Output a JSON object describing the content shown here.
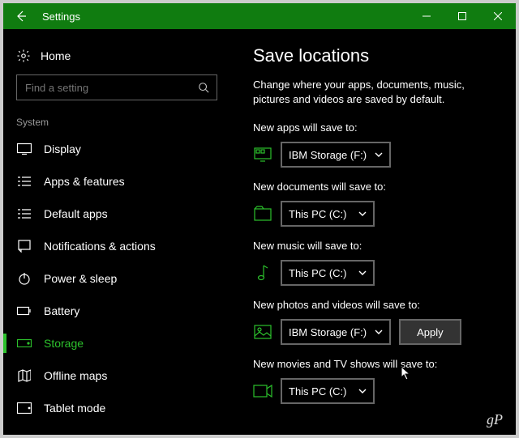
{
  "window": {
    "title": "Settings"
  },
  "sidebar": {
    "home": "Home",
    "search_placeholder": "Find a setting",
    "section": "System",
    "items": [
      {
        "label": "Display"
      },
      {
        "label": "Apps & features"
      },
      {
        "label": "Default apps"
      },
      {
        "label": "Notifications & actions"
      },
      {
        "label": "Power & sleep"
      },
      {
        "label": "Battery"
      },
      {
        "label": "Storage"
      },
      {
        "label": "Offline maps"
      },
      {
        "label": "Tablet mode"
      }
    ]
  },
  "page": {
    "title": "Save locations",
    "description": "Change where your apps, documents, music, pictures and videos are saved by default.",
    "groups": [
      {
        "label": "New apps will save to:",
        "value": "IBM Storage (F:)"
      },
      {
        "label": "New documents will save to:",
        "value": "This PC (C:)"
      },
      {
        "label": "New music will save to:",
        "value": "This PC (C:)"
      },
      {
        "label": "New photos and videos will save to:",
        "value": "IBM Storage (F:)",
        "apply": "Apply"
      },
      {
        "label": "New movies and TV shows will save to:",
        "value": "This PC (C:)"
      }
    ]
  },
  "watermark": "gP"
}
